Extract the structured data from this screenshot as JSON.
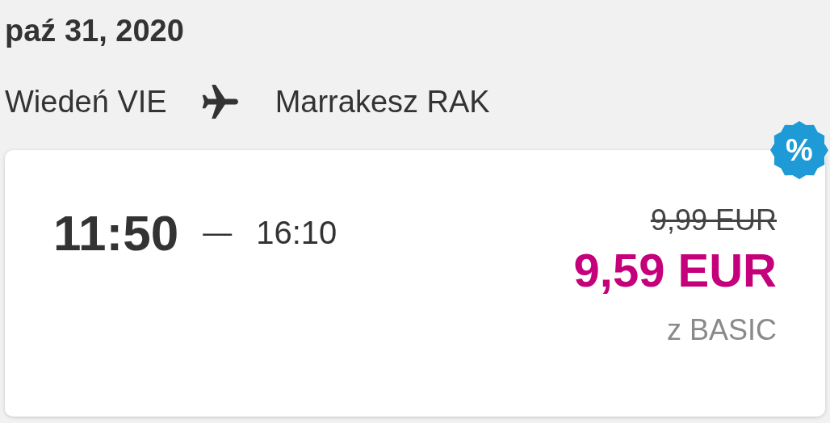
{
  "date": "paź 31, 2020",
  "route": {
    "origin": "Wiedeń VIE",
    "destination": "Marrakesz RAK"
  },
  "flight": {
    "departure": "11:50",
    "separator": "—",
    "arrival": "16:10",
    "old_price": "9,99 EUR",
    "price": "9,59 EUR",
    "fare": "z BASIC",
    "badge": "%"
  }
}
